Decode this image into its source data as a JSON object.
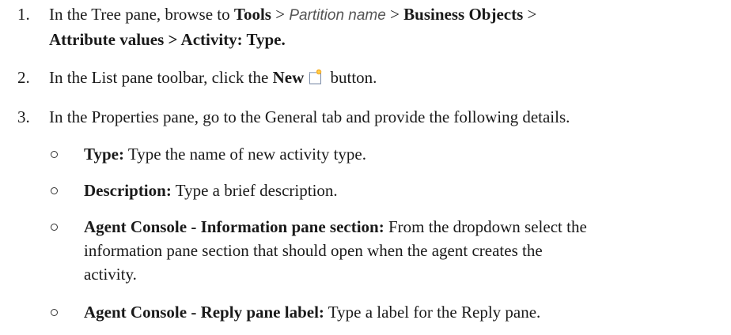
{
  "steps": [
    {
      "number": "1.",
      "pre": "In the Tree pane, browse to",
      "tools": "Tools",
      "sep1": ">",
      "partition": "Partition name",
      "sep2": ">",
      "bo": "Business Objects",
      "sep3": ">",
      "line2": "Attribute values > Activity: Type."
    },
    {
      "number": "2.",
      "pre": "In the List pane toolbar, click the",
      "new": "New",
      "post": "button.",
      "icon": "new-document-icon"
    },
    {
      "number": "3.",
      "text": "In the Properties pane, go to the General tab and provide the following details."
    }
  ],
  "bullets": [
    {
      "label": "Type:",
      "text": "Type the name of new activity type."
    },
    {
      "label": "Description:",
      "text": "Type a brief description."
    },
    {
      "label": "Agent Console - Information pane section:",
      "text": "From the dropdown select the",
      "line2": "information pane section that should open when the agent creates the",
      "line3": "activity."
    },
    {
      "label": "Agent Console - Reply pane label:",
      "text": "Type a label for the Reply pane."
    }
  ]
}
